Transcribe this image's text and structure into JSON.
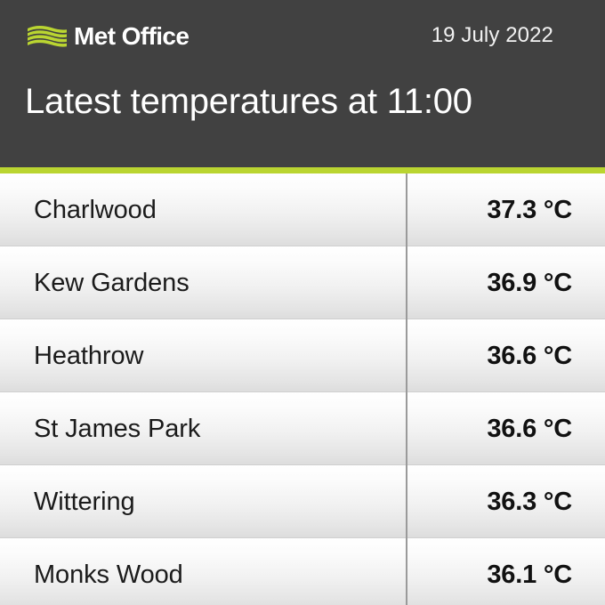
{
  "header": {
    "brand_name": "Met Office",
    "logo_icon": "met-office-wave-flag-icon",
    "date": "19 July 2022",
    "title": "Latest temperatures at 11:00",
    "background_color": "#414141",
    "accent_color": "#bad531",
    "logo_color": "#bad531",
    "text_color": "#ffffff"
  },
  "table": {
    "rows": [
      {
        "station": "Charlwood",
        "temperature": "37.3 °C"
      },
      {
        "station": "Kew Gardens",
        "temperature": "36.9 °C"
      },
      {
        "station": "Heathrow",
        "temperature": "36.6 °C"
      },
      {
        "station": "St James Park",
        "temperature": "36.6 °C"
      },
      {
        "station": "Wittering",
        "temperature": "36.3 °C"
      },
      {
        "station": "Monks Wood",
        "temperature": "36.1 °C"
      }
    ]
  }
}
